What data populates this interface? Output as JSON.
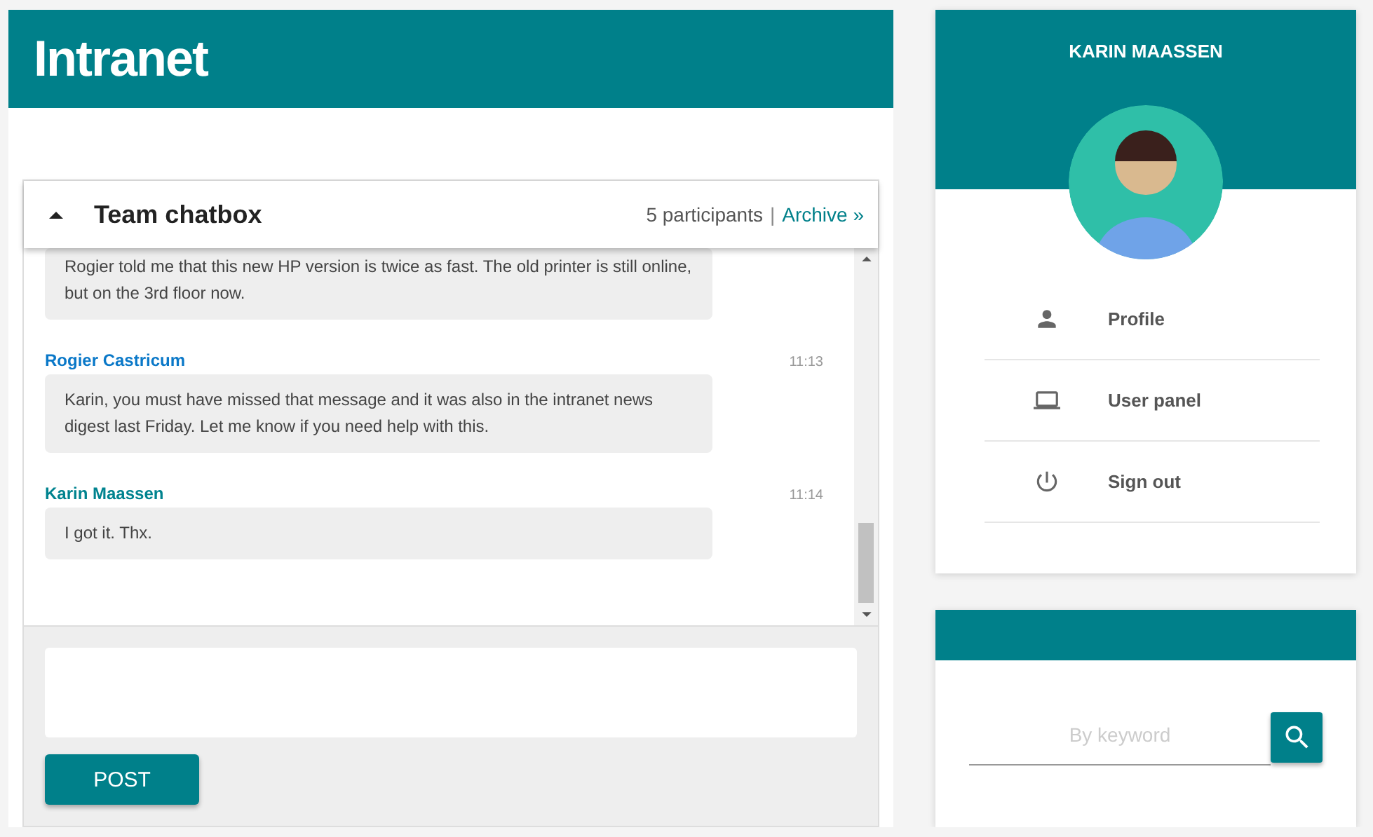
{
  "header": {
    "title": "Intranet"
  },
  "chat": {
    "title": "Team chatbox",
    "expanded": true,
    "participants": "5 participants",
    "separator": "|",
    "archive_link": "Archive »",
    "messages": [
      {
        "text": "Rogier told me that this new HP version is twice as fast. The old printer is still online, but on the 3rd floor now."
      },
      {
        "author": "Rogier Castricum",
        "color": "#0a78c8",
        "time": "11:13",
        "text": "Karin, you must have missed that message and it was also in the intranet news digest last Friday. Let me know if you need help with this."
      },
      {
        "author": "Karin Maassen",
        "color": "#00838f",
        "time": "11:14",
        "text": "I got it. Thx."
      }
    ],
    "post_button": "POST"
  },
  "user_card": {
    "name": "KARIN MAASSEN",
    "menu": [
      {
        "kind": "person",
        "label": "Profile"
      },
      {
        "kind": "laptop",
        "label": "User panel"
      },
      {
        "kind": "power",
        "label": "Sign out"
      }
    ]
  },
  "search": {
    "placeholder": "By keyword"
  }
}
